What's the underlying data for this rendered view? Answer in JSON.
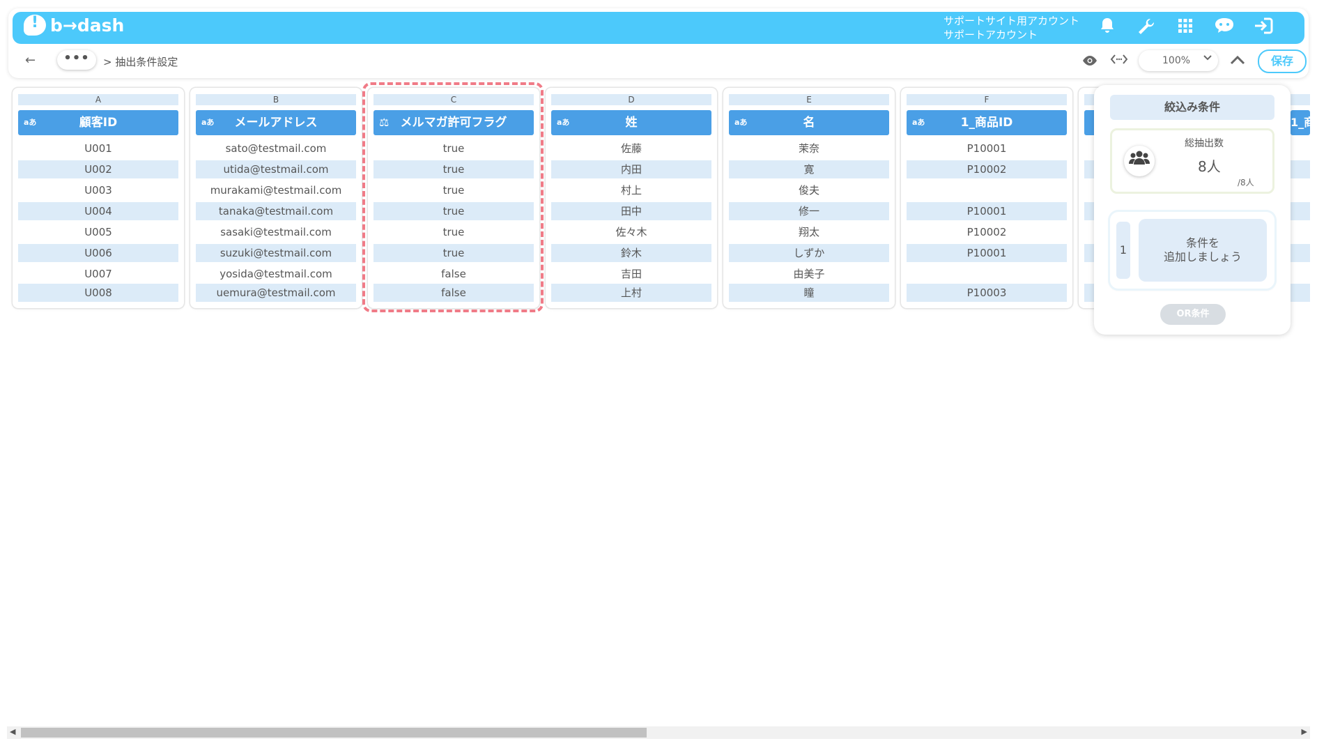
{
  "header": {
    "logo_text": "b→dash",
    "account_line1": "サポートサイト用アカウント",
    "account_line2": "サポートアカウント",
    "icons": [
      "bell-icon",
      "wrench-icon",
      "grid-icon",
      "chat-icon",
      "logout-icon"
    ]
  },
  "subbar": {
    "back_glyph": "←",
    "dots": "•••",
    "breadcrumb": "> 抽出条件設定",
    "zoom": "100%",
    "save_label": "保存"
  },
  "columns": [
    {
      "letter": "A",
      "type": "aあ",
      "title": "顧客ID",
      "cells": [
        "U001",
        "U002",
        "U003",
        "U004",
        "U005",
        "U006",
        "U007",
        "U008"
      ]
    },
    {
      "letter": "B",
      "type": "aあ",
      "title": "メールアドレス",
      "cells": [
        "sato@testmail.com",
        "utida@testmail.com",
        "murakami@testmail.com",
        "tanaka@testmail.com",
        "sasaki@testmail.com",
        "suzuki@testmail.com",
        "yosida@testmail.com",
        "uemura@testmail.com"
      ]
    },
    {
      "letter": "C",
      "type": "⚖",
      "title": "メルマガ許可フラグ",
      "cells": [
        "true",
        "true",
        "true",
        "true",
        "true",
        "true",
        "false",
        "false"
      ]
    },
    {
      "letter": "D",
      "type": "aあ",
      "title": "姓",
      "cells": [
        "佐藤",
        "内田",
        "村上",
        "田中",
        "佐々木",
        "鈴木",
        "吉田",
        "上村"
      ]
    },
    {
      "letter": "E",
      "type": "aあ",
      "title": "名",
      "cells": [
        "茉奈",
        "寛",
        "俊夫",
        "修一",
        "翔太",
        "しずか",
        "由美子",
        "瞳"
      ]
    },
    {
      "letter": "F",
      "type": "aあ",
      "title": "1_商品ID",
      "cells": [
        "P10001",
        "P10002",
        "",
        "P10001",
        "P10002",
        "P10001",
        "",
        "P10003"
      ]
    }
  ],
  "partial_header": "1_商",
  "panel": {
    "title": "絞込み条件",
    "count_label": "総抽出数",
    "count_value": "8人",
    "count_total": "/8人",
    "condition_number": "1",
    "add_condition_line1": "条件を",
    "add_condition_line2": "追加しましょう",
    "or_label": "OR条件"
  }
}
